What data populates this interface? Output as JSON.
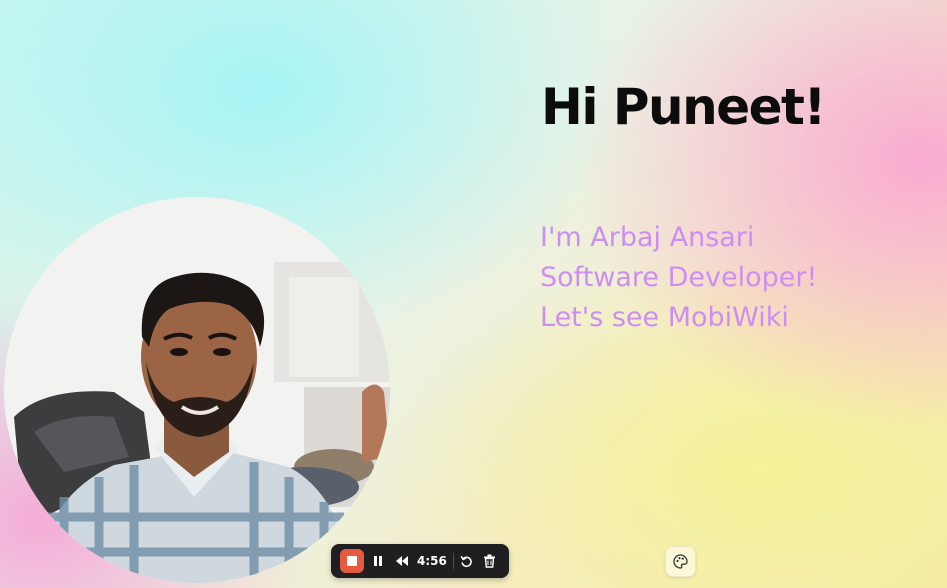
{
  "slide": {
    "greeting": "Hi Puneet!",
    "intro_lines": [
      "I'm Arbaj Ansari",
      "Software Developer!",
      "Let's see MobiWiki"
    ]
  },
  "camera": {
    "subject": "webcam-presenter"
  },
  "recorder": {
    "timer": "4:56",
    "controls": [
      "stop",
      "pause",
      "rewind",
      "restart",
      "delete"
    ]
  },
  "tools": {
    "palette_icon": "palette-icon"
  },
  "colors": {
    "greeting": "#0c0c0c",
    "intro": "#cd8ef3",
    "stop": "#e65b40",
    "control_bar": "#1f1f22"
  }
}
